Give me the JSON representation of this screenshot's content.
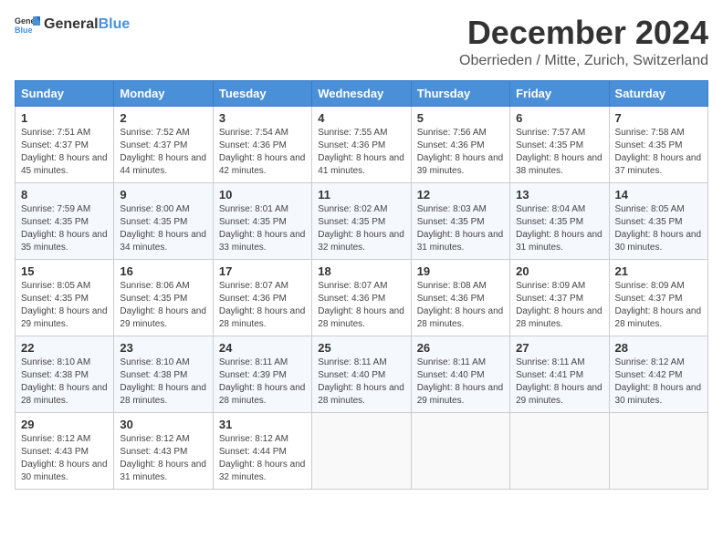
{
  "header": {
    "logo_general": "General",
    "logo_blue": "Blue",
    "month_title": "December 2024",
    "location": "Oberrieden / Mitte, Zurich, Switzerland"
  },
  "calendar": {
    "days_of_week": [
      "Sunday",
      "Monday",
      "Tuesday",
      "Wednesday",
      "Thursday",
      "Friday",
      "Saturday"
    ],
    "weeks": [
      [
        {
          "day": "1",
          "sunrise": "7:51 AM",
          "sunset": "4:37 PM",
          "daylight": "8 hours and 45 minutes."
        },
        {
          "day": "2",
          "sunrise": "7:52 AM",
          "sunset": "4:37 PM",
          "daylight": "8 hours and 44 minutes."
        },
        {
          "day": "3",
          "sunrise": "7:54 AM",
          "sunset": "4:36 PM",
          "daylight": "8 hours and 42 minutes."
        },
        {
          "day": "4",
          "sunrise": "7:55 AM",
          "sunset": "4:36 PM",
          "daylight": "8 hours and 41 minutes."
        },
        {
          "day": "5",
          "sunrise": "7:56 AM",
          "sunset": "4:36 PM",
          "daylight": "8 hours and 39 minutes."
        },
        {
          "day": "6",
          "sunrise": "7:57 AM",
          "sunset": "4:35 PM",
          "daylight": "8 hours and 38 minutes."
        },
        {
          "day": "7",
          "sunrise": "7:58 AM",
          "sunset": "4:35 PM",
          "daylight": "8 hours and 37 minutes."
        }
      ],
      [
        {
          "day": "8",
          "sunrise": "7:59 AM",
          "sunset": "4:35 PM",
          "daylight": "8 hours and 35 minutes."
        },
        {
          "day": "9",
          "sunrise": "8:00 AM",
          "sunset": "4:35 PM",
          "daylight": "8 hours and 34 minutes."
        },
        {
          "day": "10",
          "sunrise": "8:01 AM",
          "sunset": "4:35 PM",
          "daylight": "8 hours and 33 minutes."
        },
        {
          "day": "11",
          "sunrise": "8:02 AM",
          "sunset": "4:35 PM",
          "daylight": "8 hours and 32 minutes."
        },
        {
          "day": "12",
          "sunrise": "8:03 AM",
          "sunset": "4:35 PM",
          "daylight": "8 hours and 31 minutes."
        },
        {
          "day": "13",
          "sunrise": "8:04 AM",
          "sunset": "4:35 PM",
          "daylight": "8 hours and 31 minutes."
        },
        {
          "day": "14",
          "sunrise": "8:05 AM",
          "sunset": "4:35 PM",
          "daylight": "8 hours and 30 minutes."
        }
      ],
      [
        {
          "day": "15",
          "sunrise": "8:05 AM",
          "sunset": "4:35 PM",
          "daylight": "8 hours and 29 minutes."
        },
        {
          "day": "16",
          "sunrise": "8:06 AM",
          "sunset": "4:35 PM",
          "daylight": "8 hours and 29 minutes."
        },
        {
          "day": "17",
          "sunrise": "8:07 AM",
          "sunset": "4:36 PM",
          "daylight": "8 hours and 28 minutes."
        },
        {
          "day": "18",
          "sunrise": "8:07 AM",
          "sunset": "4:36 PM",
          "daylight": "8 hours and 28 minutes."
        },
        {
          "day": "19",
          "sunrise": "8:08 AM",
          "sunset": "4:36 PM",
          "daylight": "8 hours and 28 minutes."
        },
        {
          "day": "20",
          "sunrise": "8:09 AM",
          "sunset": "4:37 PM",
          "daylight": "8 hours and 28 minutes."
        },
        {
          "day": "21",
          "sunrise": "8:09 AM",
          "sunset": "4:37 PM",
          "daylight": "8 hours and 28 minutes."
        }
      ],
      [
        {
          "day": "22",
          "sunrise": "8:10 AM",
          "sunset": "4:38 PM",
          "daylight": "8 hours and 28 minutes."
        },
        {
          "day": "23",
          "sunrise": "8:10 AM",
          "sunset": "4:38 PM",
          "daylight": "8 hours and 28 minutes."
        },
        {
          "day": "24",
          "sunrise": "8:11 AM",
          "sunset": "4:39 PM",
          "daylight": "8 hours and 28 minutes."
        },
        {
          "day": "25",
          "sunrise": "8:11 AM",
          "sunset": "4:40 PM",
          "daylight": "8 hours and 28 minutes."
        },
        {
          "day": "26",
          "sunrise": "8:11 AM",
          "sunset": "4:40 PM",
          "daylight": "8 hours and 29 minutes."
        },
        {
          "day": "27",
          "sunrise": "8:11 AM",
          "sunset": "4:41 PM",
          "daylight": "8 hours and 29 minutes."
        },
        {
          "day": "28",
          "sunrise": "8:12 AM",
          "sunset": "4:42 PM",
          "daylight": "8 hours and 30 minutes."
        }
      ],
      [
        {
          "day": "29",
          "sunrise": "8:12 AM",
          "sunset": "4:43 PM",
          "daylight": "8 hours and 30 minutes."
        },
        {
          "day": "30",
          "sunrise": "8:12 AM",
          "sunset": "4:43 PM",
          "daylight": "8 hours and 31 minutes."
        },
        {
          "day": "31",
          "sunrise": "8:12 AM",
          "sunset": "4:44 PM",
          "daylight": "8 hours and 32 minutes."
        },
        null,
        null,
        null,
        null
      ]
    ],
    "labels": {
      "sunrise": "Sunrise:",
      "sunset": "Sunset:",
      "daylight": "Daylight:"
    }
  }
}
